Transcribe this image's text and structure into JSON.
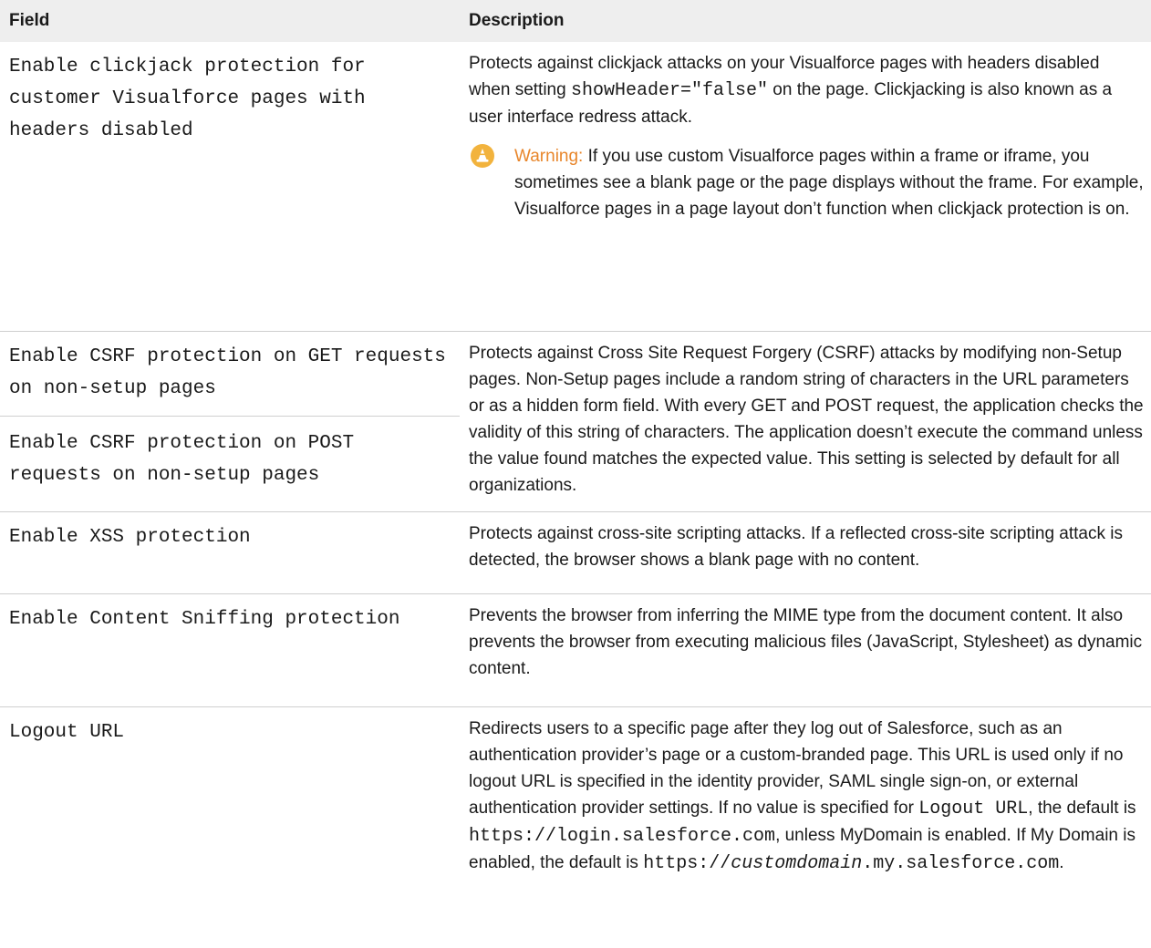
{
  "header": {
    "field": "Field",
    "description": "Description"
  },
  "rows": {
    "clickjack": {
      "field": "Enable clickjack protection for customer Visualforce pages with headers disabled",
      "desc_before_code": "Protects against clickjack attacks on your Visualforce pages with headers disabled when setting ",
      "desc_code": "showHeader=\"false\"",
      "desc_after_code": " on the page. Clickjacking is also known as a user interface redress attack.",
      "warning_label": "Warning:",
      "warning_text": " If you use custom Visualforce pages within a frame or iframe, you sometimes see a blank page or the page displays without the frame. For example, Visualforce pages in a page layout don’t function when clickjack protection is on."
    },
    "csrf": {
      "field_get": "Enable CSRF protection on GET requests on non-setup pages",
      "field_post": "Enable CSRF protection on POST requests on non-setup pages",
      "desc": "Protects against Cross Site Request Forgery (CSRF) attacks by modifying non-Setup pages. Non-Setup pages include a random string of characters in the URL parameters or as a hidden form field. With every GET and POST request, the application checks the validity of this string of characters. The application doesn’t execute the command unless the value found matches the expected value. This setting is selected by default for all organizations."
    },
    "xss": {
      "field": "Enable XSS protection",
      "desc": "Protects against cross-site scripting attacks. If a reflected cross-site scripting attack is detected, the browser shows a blank page with no content."
    },
    "sniff": {
      "field": "Enable Content Sniffing protection",
      "desc": "Prevents the browser from inferring the MIME type from the document content. It also prevents the browser from executing malicious files (JavaScript, Stylesheet) as dynamic content."
    },
    "logout": {
      "field": "Logout URL",
      "desc_part1": "Redirects users to a specific page after they log out of Salesforce, such as an authentication provider’s page or a custom-branded page. This URL is used only if no logout URL is specified in the identity provider, SAML single sign-on, or external authentication provider settings. If no value is specified for ",
      "desc_code1": "Logout URL",
      "desc_part2": ", the default is ",
      "desc_code2": "https://login.salesforce.com",
      "desc_part3": ", unless MyDomain is enabled. If My Domain is enabled, the default is ",
      "desc_code3_prefix": "https://",
      "desc_code3_italic": "customdomain",
      "desc_code3_suffix": ".my.salesforce.com",
      "desc_part4": "."
    }
  },
  "icons": {
    "warning": "warning-cone-icon"
  },
  "colors": {
    "header_bg": "#eeeeee",
    "row_border": "#cfcfcf",
    "warning_label": "#e8862b",
    "warning_icon": "#f2b33d"
  }
}
